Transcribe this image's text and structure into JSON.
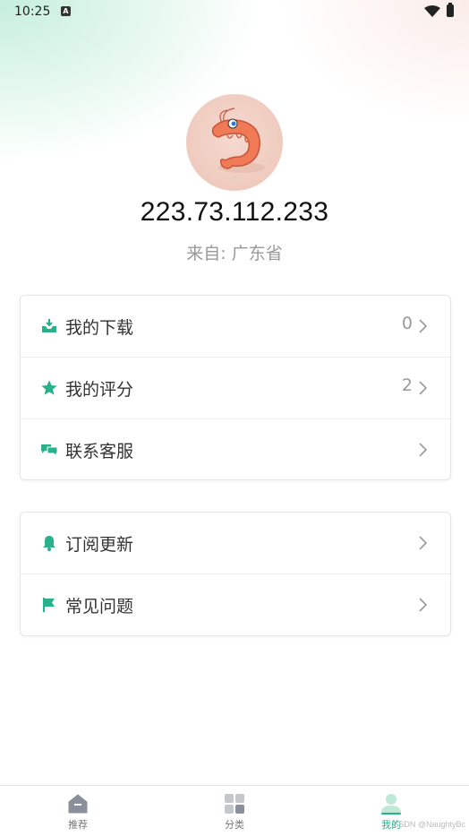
{
  "status_bar": {
    "time": "10:25",
    "notification_badge": "A"
  },
  "profile": {
    "ip": "223.73.112.233",
    "from": "来自: 广东省"
  },
  "menu_group_1": [
    {
      "label": "我的下载",
      "count": "0",
      "icon": "download-tray-icon"
    },
    {
      "label": "我的评分",
      "count": "2",
      "icon": "star-icon"
    },
    {
      "label": "联系客服",
      "count": "",
      "icon": "chat-bubbles-icon"
    }
  ],
  "menu_group_2": [
    {
      "label": "订阅更新",
      "icon": "bell-icon"
    },
    {
      "label": "常见问题",
      "icon": "flag-icon"
    }
  ],
  "bottom_nav": {
    "items": [
      {
        "label": "推荐",
        "icon": "home-icon"
      },
      {
        "label": "分类",
        "icon": "grid-icon"
      },
      {
        "label": "我的",
        "icon": "person-icon",
        "active": true
      }
    ]
  },
  "watermark": "CSDN @NaughtyBc",
  "colors": {
    "accent": "#2ab08a",
    "icon_gray": "#8a8f99"
  }
}
